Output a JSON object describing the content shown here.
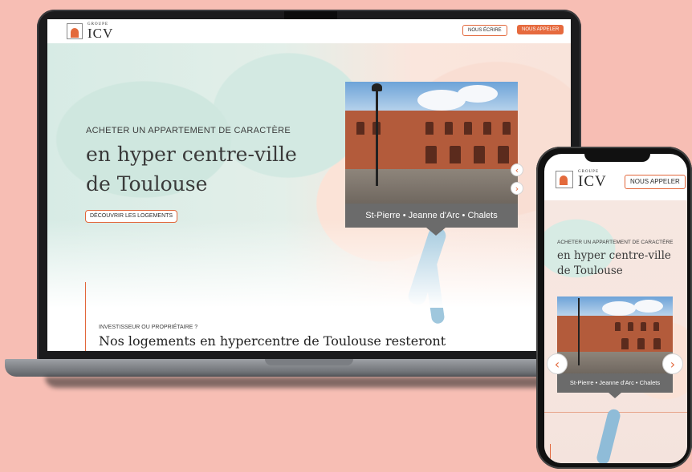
{
  "brand": {
    "logo_small": "GROUPE",
    "logo_big": "ICV"
  },
  "laptop": {
    "header": {
      "write_label": "NOUS ÉCRIRE",
      "call_label": "NOUS APPELER"
    },
    "hero": {
      "kicker": "ACHETER UN APPARTEMENT DE CARACTÈRE",
      "title_line1": "en hyper centre-ville",
      "title_line2": "de Toulouse",
      "cta_label": "DÉCOUVRIR LES LOGEMENTS"
    },
    "photo": {
      "caption": "St-Pierre • Jeanne d'Arc • Chalets"
    },
    "section": {
      "kicker": "INVESTISSEUR OU PROPRIÉTAIRE ?",
      "title": "Nos logements en hypercentre de Toulouse resteront"
    }
  },
  "phone": {
    "header": {
      "call_label": "NOUS APPELER"
    },
    "hero": {
      "kicker": "ACHETER UN APPARTEMENT DE CARACTÈRE",
      "title_line1": "en hyper centre-ville",
      "title_line2": "de Toulouse"
    },
    "photo": {
      "caption": "St-Pierre • Jeanne d'Arc • Chalets"
    }
  },
  "colors": {
    "background": "#f7beb4",
    "accent": "#e66a3e",
    "caption_bg": "#6b6b6b"
  },
  "icons": {
    "prev": "‹",
    "next": "›"
  }
}
